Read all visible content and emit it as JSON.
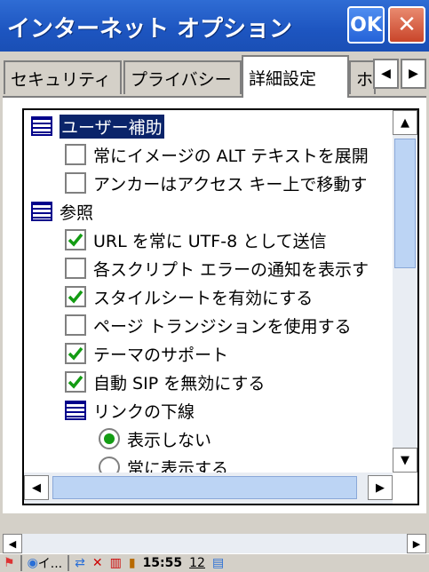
{
  "window": {
    "title": "インターネット オプション",
    "ok_label": "OK",
    "close_label": "✕"
  },
  "tabs": [
    {
      "label": "セキュリティ"
    },
    {
      "label": "プライバシー"
    },
    {
      "label": "詳細設定",
      "active": true
    },
    {
      "label": "ホ"
    }
  ],
  "tree": {
    "items": [
      {
        "label": "ユーザー補助",
        "kind": "group",
        "selected": true
      },
      {
        "label": "常にイメージの ALT テキストを展開",
        "kind": "checkbox",
        "checked": false
      },
      {
        "label": "アンカーはアクセス キー上で移動す",
        "kind": "checkbox",
        "checked": false
      },
      {
        "label": "参照",
        "kind": "group"
      },
      {
        "label": "URL を常に UTF-8 として送信",
        "kind": "checkbox",
        "checked": true
      },
      {
        "label": "各スクリプト エラーの通知を表示す",
        "kind": "checkbox",
        "checked": false
      },
      {
        "label": "スタイルシートを有効にする",
        "kind": "checkbox",
        "checked": true
      },
      {
        "label": "ページ トランジションを使用する",
        "kind": "checkbox",
        "checked": false
      },
      {
        "label": "テーマのサポート",
        "kind": "checkbox",
        "checked": true
      },
      {
        "label": "自動 SIP を無効にする",
        "kind": "checkbox",
        "checked": true
      },
      {
        "label": "リンクの下線",
        "kind": "group"
      },
      {
        "label": "表示しない",
        "kind": "radio",
        "checked": true
      },
      {
        "label": "常に表示する",
        "kind": "radio",
        "checked": false
      }
    ]
  },
  "taskbar": {
    "start_icon": "windows-flag-icon",
    "ie_button_label": "イ...",
    "clock": "15:55",
    "keyboard_label": "12"
  },
  "icons": {
    "check": "checkmark-icon",
    "group": "list-group-icon",
    "up": "arrow-up-icon",
    "down": "arrow-down-icon",
    "left": "arrow-left-icon",
    "right": "arrow-right-icon"
  },
  "colors": {
    "title_bar": "#1d55c0",
    "selection": "#0a246a",
    "check": "#139c13",
    "scroll_track": "#e9edf3",
    "scroll_thumb": "#bcd4f4"
  }
}
